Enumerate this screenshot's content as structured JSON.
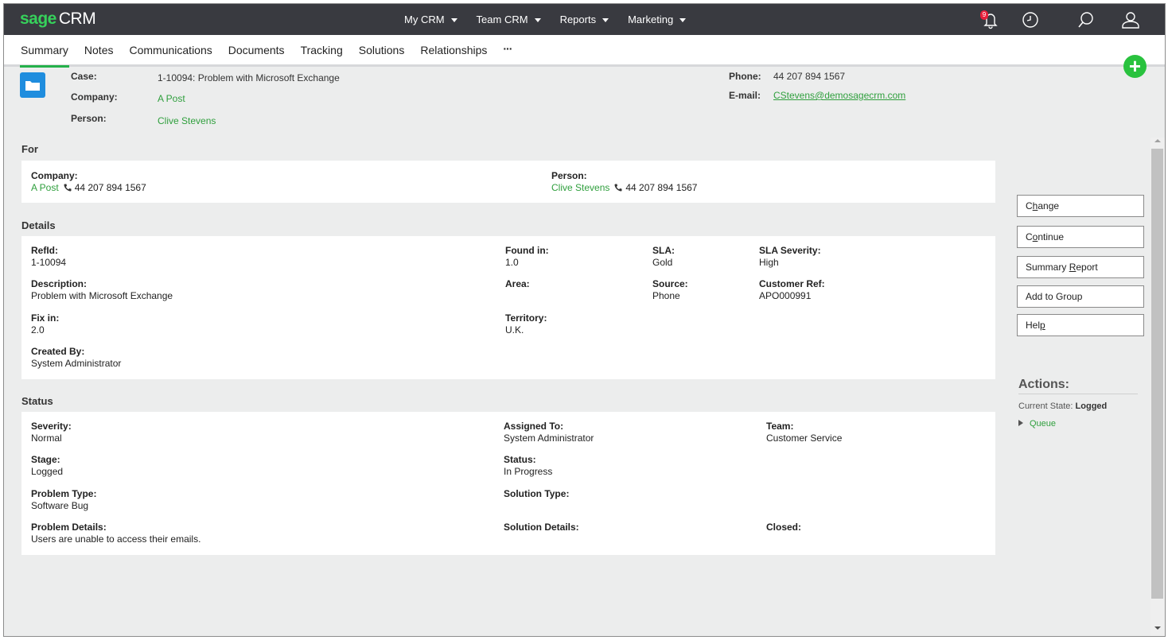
{
  "app": {
    "logo_sage": "sage",
    "logo_crm": "CRM"
  },
  "nav": {
    "items": [
      {
        "label": "My CRM"
      },
      {
        "label": "Team CRM"
      },
      {
        "label": "Reports"
      },
      {
        "label": "Marketing"
      }
    ],
    "notifications_count": "9"
  },
  "tabs": {
    "items": [
      "Summary",
      "Notes",
      "Communications",
      "Documents",
      "Tracking",
      "Solutions",
      "Relationships"
    ],
    "more": "···",
    "active": "Summary"
  },
  "header": {
    "case_label": "Case:",
    "case_value": "1-10094: Problem with Microsoft Exchange",
    "company_label": "Company:",
    "company_value": "A Post",
    "person_label": "Person:",
    "person_value": "Clive Stevens",
    "phone_label": "Phone:",
    "phone_value": "44 207 894 1567",
    "email_label": "E-mail:",
    "email_value": "CStevens@demosagecrm.com"
  },
  "for_section": {
    "title": "For",
    "company_label": "Company:",
    "company_value": "A Post",
    "company_phone": "44 207 894 1567",
    "person_label": "Person:",
    "person_value": "Clive Stevens",
    "person_phone": "44 207 894 1567"
  },
  "details": {
    "title": "Details",
    "refid_label": "RefId:",
    "refid_value": "1-10094",
    "description_label": "Description:",
    "description_value": "Problem with Microsoft Exchange",
    "fixin_label": "Fix in:",
    "fixin_value": "2.0",
    "createdby_label": "Created By:",
    "createdby_value": "System Administrator",
    "foundin_label": "Found in:",
    "foundin_value": "1.0",
    "area_label": "Area:",
    "territory_label": "Territory:",
    "territory_value": "U.K.",
    "sla_label": "SLA:",
    "sla_value": "Gold",
    "source_label": "Source:",
    "source_value": "Phone",
    "slaseverity_label": "SLA Severity:",
    "slaseverity_value": "High",
    "customerref_label": "Customer Ref:",
    "customerref_value": "APO000991"
  },
  "status": {
    "title": "Status",
    "severity_label": "Severity:",
    "severity_value": "Normal",
    "stage_label": "Stage:",
    "stage_value": "Logged",
    "problemtype_label": "Problem Type:",
    "problemtype_value": "Software Bug",
    "problemdetails_label": "Problem Details:",
    "problemdetails_value": "Users are unable to access their emails.",
    "assignedto_label": "Assigned To:",
    "assignedto_value": "System Administrator",
    "status_label": "Status:",
    "status_value": "In Progress",
    "solutiontype_label": "Solution Type:",
    "solutiondetails_label": "Solution Details:",
    "team_label": "Team:",
    "team_value": "Customer Service",
    "closed_label": "Closed:"
  },
  "side_buttons": {
    "change_pre": "C",
    "change_u": "h",
    "change_post": "ange",
    "continue_pre": "C",
    "continue_u": "o",
    "continue_post": "ntinue",
    "summary_pre": "Summary ",
    "summary_u": "R",
    "summary_post": "eport",
    "addgroup": "Add to Group",
    "help_pre": "Hel",
    "help_u": "p"
  },
  "actions": {
    "title": "Actions:",
    "state_label": "Current State: ",
    "state_value": "Logged",
    "queue": "Queue"
  },
  "colors": {
    "accent": "#2f9f3d",
    "topbar": "#393a40",
    "icon_blue": "#1f8dde",
    "add_green": "#29c23e",
    "badge_red": "#e8203c"
  }
}
